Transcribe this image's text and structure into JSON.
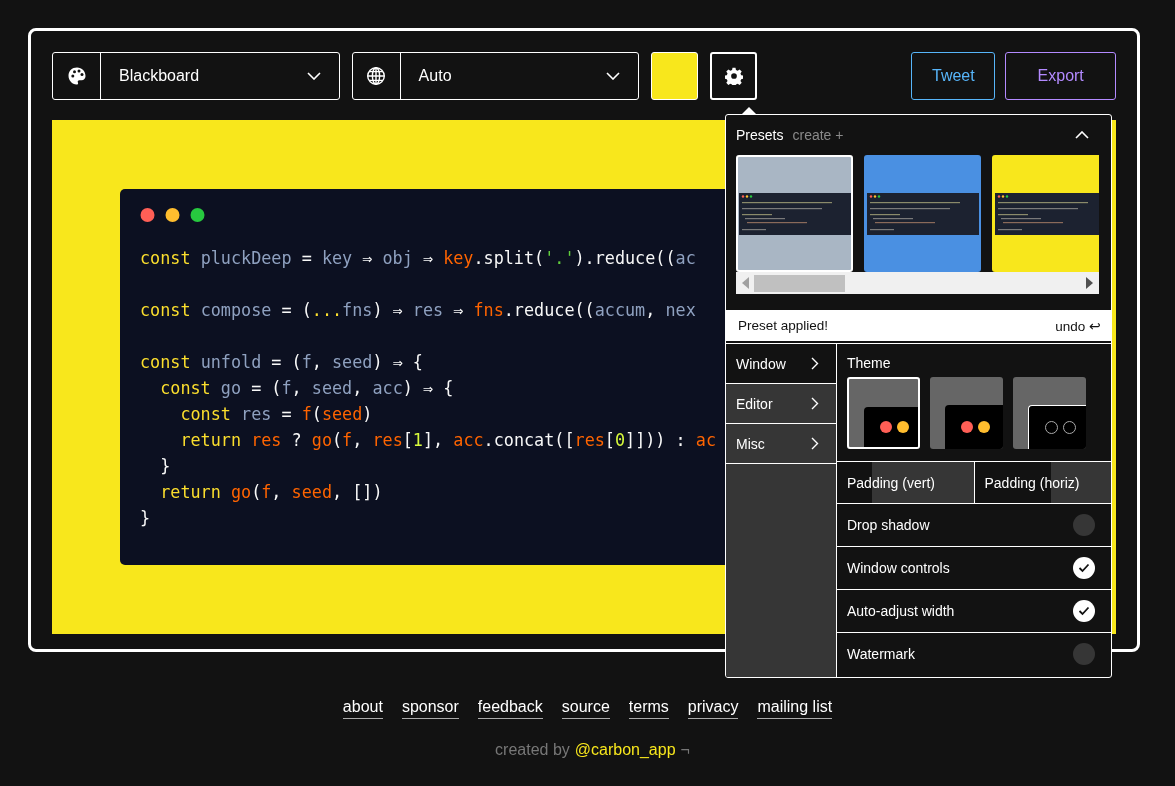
{
  "toolbar": {
    "theme_select": {
      "value": "Blackboard"
    },
    "language_select": {
      "value": "Auto"
    },
    "settings_open": true,
    "buttons": [
      {
        "label": "Tweet",
        "kind": "tweet"
      },
      {
        "label": "Export",
        "kind": "export"
      }
    ]
  },
  "editor": {
    "window_controls": true,
    "blocks": [
      {
        "lines": [
          [
            {
              "kind": "kw",
              "text": "const"
            },
            {
              "kind": "id",
              "text": " pluckDeep"
            },
            {
              "kind": "pl",
              "text": " = "
            },
            {
              "kind": "id",
              "text": "key"
            },
            {
              "kind": "pl",
              "text": " ⇒ "
            },
            {
              "kind": "id",
              "text": "obj"
            },
            {
              "kind": "pl",
              "text": " ⇒ "
            },
            {
              "kind": "fn",
              "text": "key"
            },
            {
              "kind": "pl",
              "text": ".split("
            },
            {
              "kind": "str",
              "text": "'.'"
            },
            {
              "kind": "pl",
              "text": ").reduce(("
            },
            {
              "kind": "id",
              "text": "ac"
            }
          ]
        ]
      },
      {
        "lines": [
          [
            {
              "kind": "kw",
              "text": "const"
            },
            {
              "kind": "id",
              "text": " compose"
            },
            {
              "kind": "pl",
              "text": " = ("
            },
            {
              "kind": "kw",
              "text": "..."
            },
            {
              "kind": "id",
              "text": "fns"
            },
            {
              "kind": "pl",
              "text": ") ⇒ "
            },
            {
              "kind": "id",
              "text": "res"
            },
            {
              "kind": "pl",
              "text": " ⇒ "
            },
            {
              "kind": "fn",
              "text": "fns"
            },
            {
              "kind": "pl",
              "text": ".reduce(("
            },
            {
              "kind": "id",
              "text": "accum"
            },
            {
              "kind": "pl",
              "text": ", "
            },
            {
              "kind": "id",
              "text": "nex"
            }
          ]
        ]
      },
      {
        "lines": [
          [
            {
              "kind": "kw",
              "text": "const"
            },
            {
              "kind": "id",
              "text": " unfold"
            },
            {
              "kind": "pl",
              "text": " = ("
            },
            {
              "kind": "id",
              "text": "f"
            },
            {
              "kind": "pl",
              "text": ", "
            },
            {
              "kind": "id",
              "text": "seed"
            },
            {
              "kind": "pl",
              "text": ") ⇒ {"
            }
          ],
          [
            {
              "kind": "kw",
              "text": "  const"
            },
            {
              "kind": "id",
              "text": " go"
            },
            {
              "kind": "pl",
              "text": " = ("
            },
            {
              "kind": "id",
              "text": "f"
            },
            {
              "kind": "pl",
              "text": ", "
            },
            {
              "kind": "id",
              "text": "seed"
            },
            {
              "kind": "pl",
              "text": ", "
            },
            {
              "kind": "id",
              "text": "acc"
            },
            {
              "kind": "pl",
              "text": ") ⇒ {"
            }
          ],
          [
            {
              "kind": "kw",
              "text": "    const"
            },
            {
              "kind": "id",
              "text": " res"
            },
            {
              "kind": "pl",
              "text": " = "
            },
            {
              "kind": "fn",
              "text": "f"
            },
            {
              "kind": "pl",
              "text": "("
            },
            {
              "kind": "fn",
              "text": "seed"
            },
            {
              "kind": "pl",
              "text": ")"
            }
          ],
          [
            {
              "kind": "kw",
              "text": "    return"
            },
            {
              "kind": "fn",
              "text": " res"
            },
            {
              "kind": "pl",
              "text": " ? "
            },
            {
              "kind": "fn",
              "text": "go"
            },
            {
              "kind": "pl",
              "text": "("
            },
            {
              "kind": "fn",
              "text": "f"
            },
            {
              "kind": "pl",
              "text": ", "
            },
            {
              "kind": "fn",
              "text": "res"
            },
            {
              "kind": "pl",
              "text": "["
            },
            {
              "kind": "num",
              "text": "1"
            },
            {
              "kind": "pl",
              "text": "], "
            },
            {
              "kind": "fn",
              "text": "acc"
            },
            {
              "kind": "pl",
              "text": ".concat(["
            },
            {
              "kind": "fn",
              "text": "res"
            },
            {
              "kind": "pl",
              "text": "["
            },
            {
              "kind": "num",
              "text": "0"
            },
            {
              "kind": "pl",
              "text": "]])) : "
            },
            {
              "kind": "fn",
              "text": "ac"
            }
          ],
          [
            {
              "kind": "pl",
              "text": "  }"
            }
          ],
          [
            {
              "kind": "kw",
              "text": "  return"
            },
            {
              "kind": "fn",
              "text": " go"
            },
            {
              "kind": "pl",
              "text": "("
            },
            {
              "kind": "fn",
              "text": "f"
            },
            {
              "kind": "pl",
              "text": ", "
            },
            {
              "kind": "fn",
              "text": "seed"
            },
            {
              "kind": "pl",
              "text": ", [])"
            }
          ],
          [
            {
              "kind": "pl",
              "text": "}"
            }
          ]
        ]
      }
    ]
  },
  "settings": {
    "presets": {
      "title": "Presets",
      "create": "create +",
      "expanded": true,
      "items": [
        {
          "color": "#a9b6c4",
          "selected": true
        },
        {
          "color": "#4a90e2",
          "selected": false
        },
        {
          "color": "#f8e71c",
          "selected": false
        }
      ],
      "message": "Preset applied!",
      "undo": "undo ↩"
    },
    "menu": [
      {
        "label": "Window",
        "selected": true
      },
      {
        "label": "Editor",
        "selected": false
      },
      {
        "label": "Misc",
        "selected": false
      }
    ],
    "theme": {
      "label": "Theme",
      "options": [
        {
          "kind": "filled",
          "selected": true
        },
        {
          "kind": "filled",
          "selected": false
        },
        {
          "kind": "outline",
          "selected": false
        }
      ]
    },
    "paddings": [
      {
        "label": "Padding (vert)",
        "level": 0.26
      },
      {
        "label": "Padding (horiz)",
        "level": 0.56
      }
    ],
    "toggles": [
      {
        "label": "Drop shadow",
        "checked": false
      },
      {
        "label": "Window controls",
        "checked": true
      },
      {
        "label": "Auto-adjust width",
        "checked": true
      },
      {
        "label": "Watermark",
        "checked": false
      }
    ]
  },
  "footer": {
    "links": [
      "about",
      "sponsor",
      "feedback",
      "source",
      "terms",
      "privacy",
      "mailing list"
    ],
    "credit": {
      "prefix": "created by",
      "handle": "@carbon_app",
      "suffix": "¬"
    }
  }
}
